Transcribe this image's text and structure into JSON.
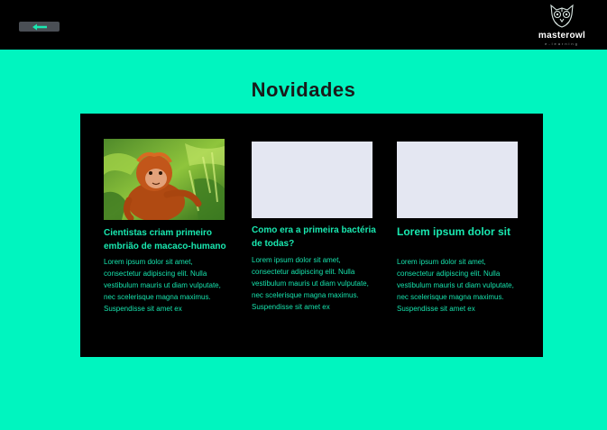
{
  "header": {
    "back_icon": "arrow-left-icon",
    "logo_name": "masterowl",
    "logo_sub": "e-learning",
    "logo_icon": "owl-icon"
  },
  "page": {
    "title": "Novidades"
  },
  "cards": [
    {
      "title": "Cientistas criam primeiro embrião de macaco-humano",
      "body": "Lorem ipsum dolor sit amet, consectetur adipiscing elit. Nulla vestibulum mauris ut diam vulputate, nec scelerisque magna maximus. Suspendisse sit amet ex",
      "image": "orangutan-photo"
    },
    {
      "title": "Como era a primeira bactéria de todas?",
      "body": "Lorem ipsum dolor sit amet, consectetur adipiscing elit. Nulla vestibulum mauris ut diam vulputate, nec scelerisque magna maximus. Suspendisse sit amet ex",
      "image": "placeholder"
    },
    {
      "title": "Lorem ipsum dolor sit",
      "body": "Lorem ipsum dolor sit amet, consectetur adipiscing elit. Nulla vestibulum mauris ut diam vulputate, nec scelerisque magna maximus. Suspendisse sit amet ex",
      "image": "placeholder"
    }
  ],
  "colors": {
    "background": "#00f5bf",
    "header": "#000000",
    "panel": "#000000",
    "accent_text": "#19e8b0",
    "placeholder": "#e4e7f2"
  }
}
